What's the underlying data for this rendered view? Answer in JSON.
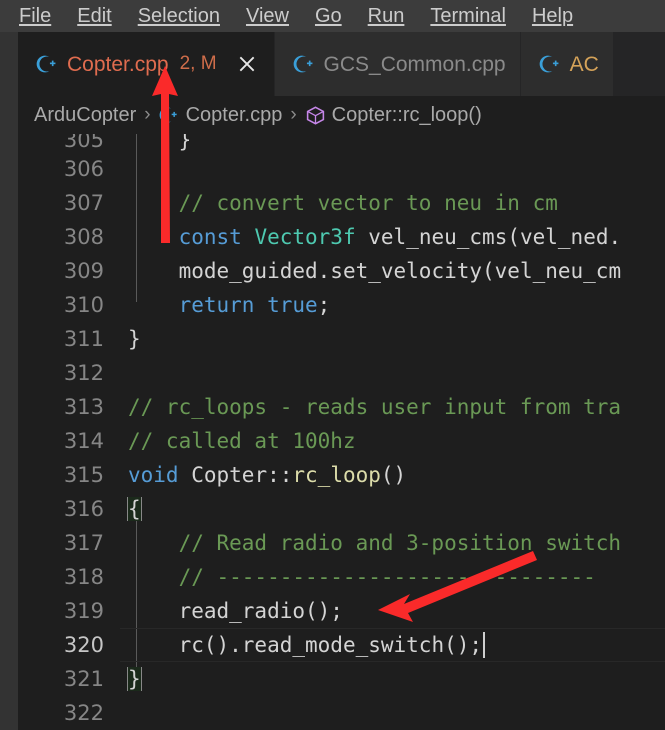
{
  "window": {
    "theme_background": "#1e1e1e",
    "menubar_background": "#3c3c3c",
    "accent_modified": "#e06c4f"
  },
  "menubar": {
    "items": [
      {
        "label": "File",
        "mnemonic": "F"
      },
      {
        "label": "Edit",
        "mnemonic": "E"
      },
      {
        "label": "Selection",
        "mnemonic": "S"
      },
      {
        "label": "View",
        "mnemonic": "V"
      },
      {
        "label": "Go",
        "mnemonic": "G"
      },
      {
        "label": "Run",
        "mnemonic": "R"
      },
      {
        "label": "Terminal",
        "mnemonic": "T"
      },
      {
        "label": "Help",
        "mnemonic": "H"
      }
    ]
  },
  "tabs": [
    {
      "label": "Copter.cpp",
      "badge": "2, M",
      "icon": "cpp-file-icon",
      "active": true,
      "close_icon": "close-icon"
    },
    {
      "label": "GCS_Common.cpp",
      "badge": "",
      "icon": "cpp-file-icon",
      "active": false,
      "close_icon": ""
    },
    {
      "label": "AC",
      "badge": "",
      "icon": "cpp-file-icon",
      "active": false,
      "close_icon": ""
    }
  ],
  "breadcrumbs": {
    "items": [
      {
        "label": "ArduCopter",
        "icon": ""
      },
      {
        "label": "Copter.cpp",
        "icon": "cpp-file-icon"
      },
      {
        "label": "Copter::rc_loop()",
        "icon": "symbol-method-icon"
      }
    ],
    "separator": "›"
  },
  "editor": {
    "active_line_number": 320,
    "cursor_line": 320,
    "lines": [
      {
        "n": "305",
        "text": "    }"
      },
      {
        "n": "306",
        "text": ""
      },
      {
        "n": "307",
        "text": "    // convert vector to neu in cm"
      },
      {
        "n": "308",
        "text": "    const Vector3f vel_neu_cms(vel_ned."
      },
      {
        "n": "309",
        "text": "    mode_guided.set_velocity(vel_neu_cm"
      },
      {
        "n": "310",
        "text": "    return true;"
      },
      {
        "n": "311",
        "text": "}"
      },
      {
        "n": "312",
        "text": ""
      },
      {
        "n": "313",
        "text": "// rc_loops - reads user input from tra"
      },
      {
        "n": "314",
        "text": "// called at 100hz"
      },
      {
        "n": "315",
        "text": "void Copter::rc_loop()"
      },
      {
        "n": "316",
        "text": "{"
      },
      {
        "n": "317",
        "text": "    // Read radio and 3-position switch"
      },
      {
        "n": "318",
        "text": "    // ------------------------------"
      },
      {
        "n": "319",
        "text": "    read_radio();"
      },
      {
        "n": "320",
        "text": "    rc().read_mode_switch();"
      },
      {
        "n": "321",
        "text": "}"
      },
      {
        "n": "322",
        "text": ""
      }
    ]
  },
  "annotations": {
    "arrow_color": "#fa2a2a",
    "arrows": [
      {
        "name": "arrow-to-tab-filename",
        "points_to": "Copter.cpp tab label"
      },
      {
        "name": "arrow-to-read-radio",
        "points_to": "read_radio(); call on line 319"
      }
    ]
  }
}
